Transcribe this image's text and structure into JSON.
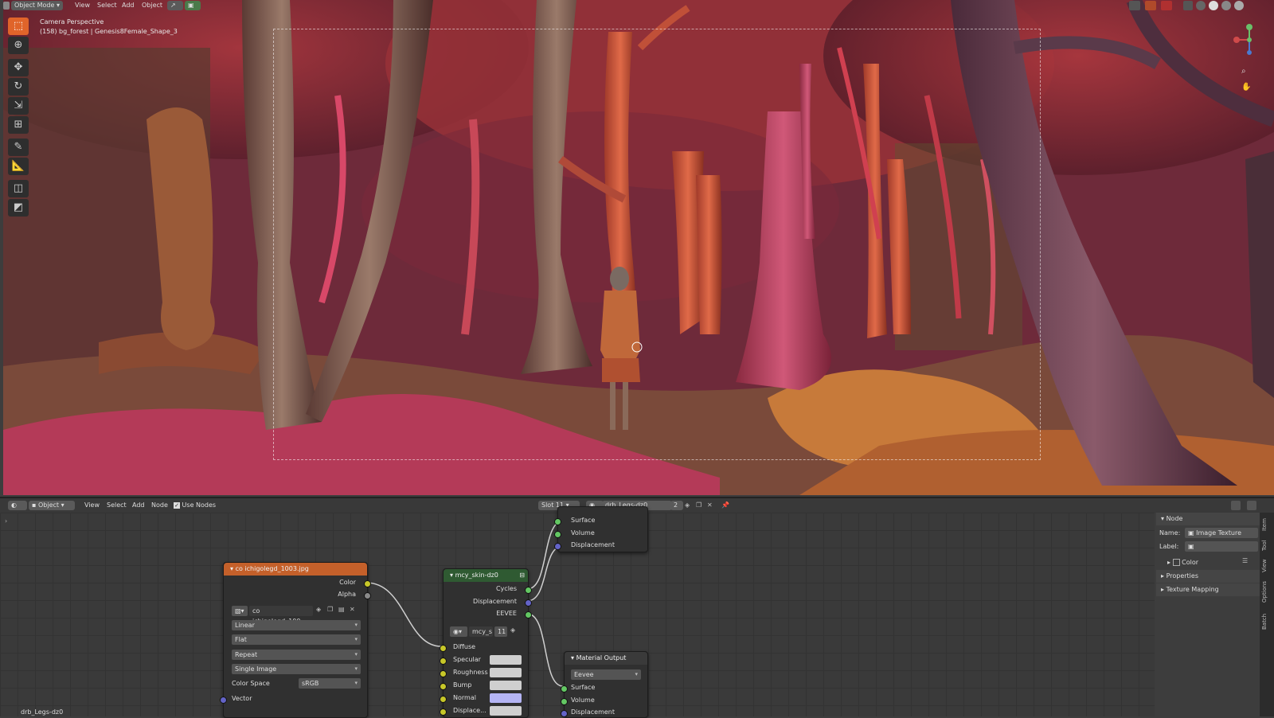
{
  "header": {
    "mode": "Object Mode",
    "menus": [
      "View",
      "Select",
      "Add",
      "Object"
    ]
  },
  "viewport": {
    "camera_line": "Camera Perspective",
    "object_line": "(158) bg_forest | Genesis8Female_Shape_3",
    "tools": [
      "select-box",
      "cursor",
      "move",
      "rotate",
      "scale",
      "transform",
      "annotate",
      "measure",
      "add-cube",
      "shear"
    ]
  },
  "node_header": {
    "object_type": "Object",
    "menus": [
      "View",
      "Select",
      "Add",
      "Node"
    ],
    "use_nodes_label": "Use Nodes",
    "use_nodes_checked": true,
    "slot": "Slot 11",
    "material": "drb_Legs-dz0",
    "users": "2"
  },
  "output_node_top": {
    "sockets": [
      "Surface",
      "Volume",
      "Displacement"
    ]
  },
  "image_node": {
    "title": "co ichigolegd_1003.jpg",
    "outputs": [
      "Color",
      "Alpha"
    ],
    "image_name": "co ichigolegd_100...",
    "interpolation": "Linear",
    "projection": "Flat",
    "extension": "Repeat",
    "source": "Single Image",
    "color_space_label": "Color Space",
    "color_space": "sRGB",
    "input": "Vector"
  },
  "group_node": {
    "title": "mcy_skin-dz0",
    "outputs": [
      "Cycles",
      "Displacement",
      "EEVEE"
    ],
    "group_name": "mcy_s",
    "group_users": "11",
    "inputs": [
      "Diffuse",
      "Specular",
      "Roughness",
      "Bump",
      "Normal",
      "Displace..."
    ]
  },
  "material_output": {
    "title": "Material Output",
    "target": "Eevee",
    "inputs": [
      "Surface",
      "Volume",
      "Displacement"
    ]
  },
  "properties_panel": {
    "section": "Node",
    "name_label": "Name:",
    "name_value": "Image Texture",
    "label_label": "Label:",
    "label_value": "",
    "color_label": "Color",
    "subsections": [
      "Properties",
      "Texture Mapping"
    ]
  },
  "side_tabs": [
    "Item",
    "Tool",
    "View",
    "Options",
    "Batch"
  ],
  "footer_material": "drb_Legs-dz0",
  "colors": {
    "accent": "#e0642a",
    "image_node_header": "#c4602a",
    "group_node_header": "#2f5a32",
    "output_node_header": "#3a3a3a",
    "socket_color": "#c7c729",
    "socket_shader": "#63c763",
    "socket_vector": "#6363c7"
  }
}
